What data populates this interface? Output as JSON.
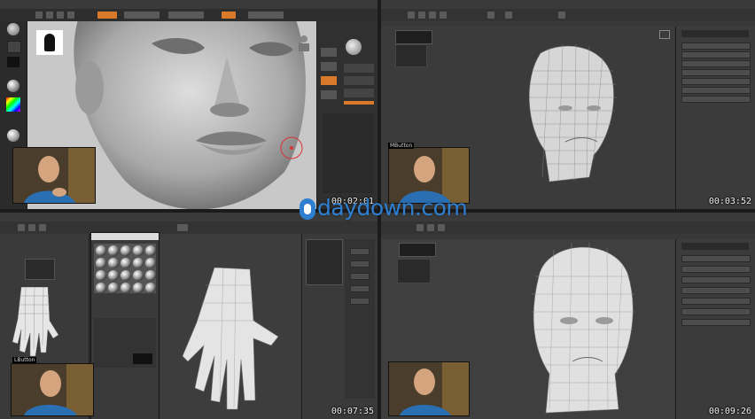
{
  "panels": [
    {
      "id": "zbrush",
      "timecode": "00:02:01",
      "software": "zbrush"
    },
    {
      "id": "max-head-wire",
      "timecode": "00:03:52",
      "viewport_label": "MButton",
      "software": "3ds-max"
    },
    {
      "id": "max-hand",
      "timecode": "00:07:35",
      "viewport_label": "LButton",
      "software": "3ds-max"
    },
    {
      "id": "max-head-final",
      "timecode": "00:09:26",
      "software": "3ds-max"
    }
  ],
  "watermark": {
    "text": "daydown.com",
    "color": "#2f7fd0"
  },
  "colors": {
    "accent_orange": "#d97a2b",
    "ui_dark": "#2d2d2d",
    "viewport_gray": "#3f3f3f",
    "zbrush_canvas": "#c9c9c9",
    "mesh_light": "#d8d8d8"
  },
  "icons": [
    "play-icon",
    "brush-icon",
    "material-sphere-icon",
    "color-picker-icon",
    "gizmo-icon",
    "move-icon",
    "rotate-icon",
    "scale-icon"
  ]
}
